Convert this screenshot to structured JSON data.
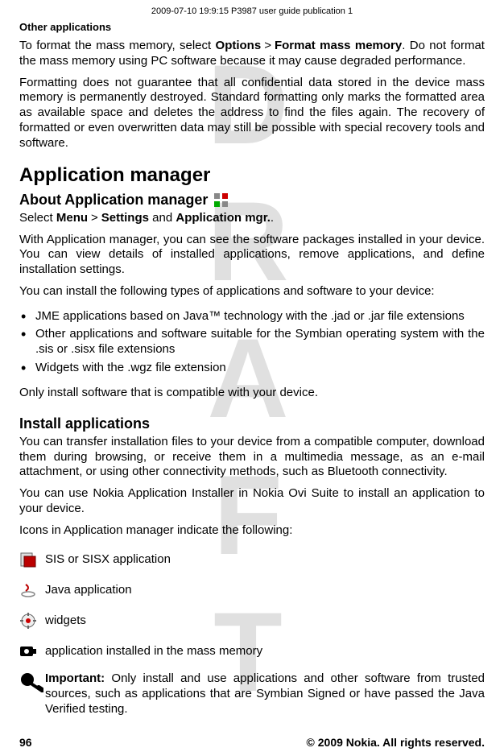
{
  "header": {
    "timestamp_line": "2009-07-10 19:9:15 P3987 user guide publication 1",
    "section": "Other applications"
  },
  "watermark": [
    "D",
    "R",
    "A",
    "F",
    "T"
  ],
  "paras": {
    "p1a": "To format the mass memory, select ",
    "p1_opt": "Options",
    "p1_gt": ">",
    "p1_fmt": "Format mass memory",
    "p1b": ". Do not format the mass memory using PC software because it may cause degraded performance.",
    "p2": "Formatting does not guarantee that all confidential data stored in the device mass memory is permanently destroyed. Standard formatting only marks the formatted area as available space and deletes the address to find the files again. The recovery of formatted or even overwritten data may still be possible with special recovery tools and software."
  },
  "h1": "Application manager",
  "h2a": "About Application manager",
  "sel": {
    "a": "Select ",
    "menu": "Menu",
    "gt": ">",
    "settings": "Settings",
    "and": " and ",
    "appmgr": "Application mgr.",
    "dot": "."
  },
  "p3": "With Application manager, you can see the software packages installed in your device. You can view details of installed applications, remove applications, and define installation settings.",
  "p4": "You can install the following types of applications and software to your device:",
  "bullets": [
    "JME applications based on Java™ technology with the .jad or .jar file extensions",
    "Other applications and software suitable for the Symbian operating system with the .sis or .sisx file extensions",
    "Widgets with the .wgz file extension"
  ],
  "p5": "Only install software that is compatible with your device.",
  "h2b": "Install applications",
  "p6": "You can transfer installation files to your device from a compatible computer, download them during browsing, or receive them in a multimedia message, as an e-mail attachment, or using other connectivity methods, such as Bluetooth connectivity.",
  "p7": "You can use Nokia Application Installer in Nokia Ovi Suite to install an application to your device.",
  "p8": "Icons in Application manager indicate the following:",
  "icons": {
    "sis": "SIS or SISX application",
    "java": "Java application",
    "widgets": "widgets",
    "mass": "application installed in the mass memory"
  },
  "important": {
    "label": "Important:",
    "text": "  Only install and use applications and other software from trusted sources, such as applications that are Symbian Signed or have passed the Java Verified testing."
  },
  "footer": {
    "page": "96",
    "copyright": "© 2009 Nokia. All rights reserved."
  }
}
